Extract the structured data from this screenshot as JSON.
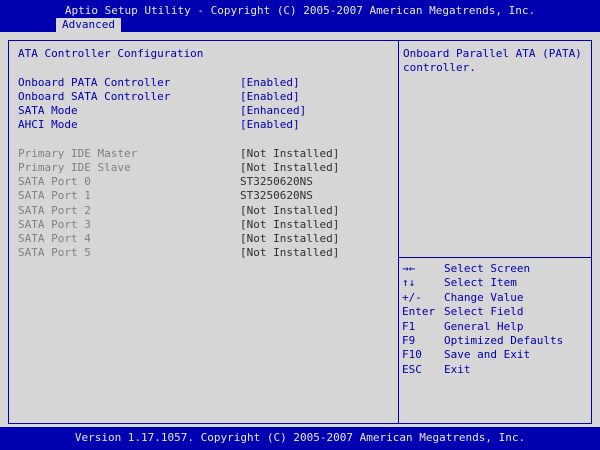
{
  "header": {
    "title": "Aptio Setup Utility - Copyright (C) 2005-2007 American Megatrends, Inc.",
    "tab": "Advanced"
  },
  "section_title": "ATA Controller Configuration",
  "settings": [
    {
      "label": "Onboard PATA Controller",
      "value": "[Enabled]"
    },
    {
      "label": "Onboard SATA Controller",
      "value": "[Enabled]"
    },
    {
      "label": "SATA Mode",
      "value": "[Enhanced]"
    },
    {
      "label": "AHCI Mode",
      "value": "[Enabled]"
    }
  ],
  "devices": [
    {
      "label": "Primary IDE Master",
      "value": "[Not Installed]"
    },
    {
      "label": "Primary IDE Slave",
      "value": "[Not Installed]"
    },
    {
      "label": "SATA Port 0",
      "value": "ST3250620NS"
    },
    {
      "label": "SATA Port 1",
      "value": "ST3250620NS"
    },
    {
      "label": "SATA Port 2",
      "value": "[Not Installed]"
    },
    {
      "label": "SATA Port 3",
      "value": "[Not Installed]"
    },
    {
      "label": "SATA Port 4",
      "value": "[Not Installed]"
    },
    {
      "label": "SATA Port 5",
      "value": "[Not Installed]"
    }
  ],
  "help_text": "Onboard Parallel ATA (PATA) controller.",
  "keys": [
    {
      "key": "→←",
      "desc": "Select Screen"
    },
    {
      "key": "↑↓",
      "desc": "Select Item"
    },
    {
      "key": "+/-",
      "desc": "Change Value"
    },
    {
      "key": "Enter",
      "desc": "Select Field"
    },
    {
      "key": "F1",
      "desc": "General Help"
    },
    {
      "key": "F9",
      "desc": "Optimized Defaults"
    },
    {
      "key": "F10",
      "desc": "Save and Exit"
    },
    {
      "key": "ESC",
      "desc": "Exit"
    }
  ],
  "footer": {
    "version": "Version 1.17.1057. Copyright (C) 2005-2007 American Megatrends, Inc."
  },
  "colors": {
    "background_blue": "#0000b0",
    "panel_gray": "#d6d6d6",
    "text_white": "#e8e8e8",
    "text_disabled": "#808080"
  }
}
